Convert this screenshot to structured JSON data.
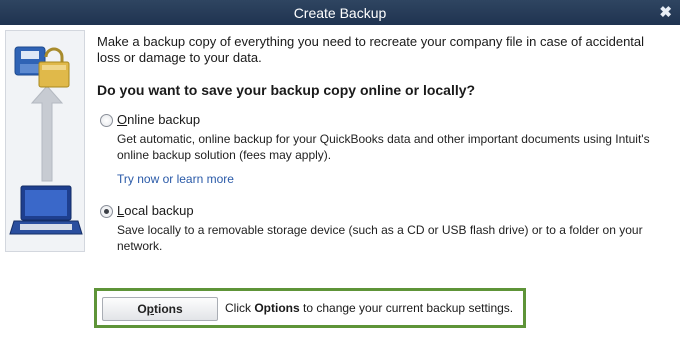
{
  "window": {
    "title": "Create Backup",
    "close_glyph": "✖"
  },
  "intro": {
    "text": "Make a backup copy of everything you need to recreate your company file in case of accidental loss or damage to your data."
  },
  "question": "Do you want to save your backup copy online or locally?",
  "options": {
    "online": {
      "label_accesskey": "O",
      "label_rest": "nline backup",
      "selected": false,
      "description": "Get automatic, online backup for your QuickBooks data and other important documents using Intuit's online backup solution (fees may apply).",
      "link": "Try now or learn more"
    },
    "local": {
      "label_accesskey": "L",
      "label_rest": "ocal backup",
      "selected": true,
      "description": "Save locally to a removable storage device (such as a CD or USB flash drive) or to a folder on your network."
    }
  },
  "settings": {
    "button_accesskey": "p",
    "button_before": "O",
    "button_after": "tions",
    "hint_prefix": "Click ",
    "hint_bold": "Options",
    "hint_suffix": " to change your current backup settings."
  },
  "colors": {
    "titlebar": "#1f3350",
    "highlight_border": "#5e9438",
    "link": "#2a5aa8"
  },
  "icons": [
    "backup-illustration-icon",
    "close-icon"
  ]
}
